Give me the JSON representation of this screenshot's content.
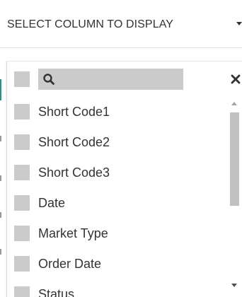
{
  "column_select": {
    "label": "SELECT COLUMN TO DISPLAY",
    "caret_icon": "caret-down-icon"
  },
  "dropdown": {
    "search": {
      "value": "",
      "placeholder": "",
      "icon": "search-icon",
      "clear_icon": "close-icon"
    },
    "items": [
      {
        "label": "Short Code1",
        "checked": false
      },
      {
        "label": "Short Code2",
        "checked": false
      },
      {
        "label": "Short Code3",
        "checked": false
      },
      {
        "label": "Date",
        "checked": false
      },
      {
        "label": "Market Type",
        "checked": false
      },
      {
        "label": "Order Date",
        "checked": false
      },
      {
        "label": "Status",
        "checked": false
      }
    ]
  },
  "colors": {
    "checkbox": "#cbcbcb",
    "text": "#333333",
    "accent": "#2f8f7f",
    "scroll_thumb": "#c1c1c1"
  }
}
